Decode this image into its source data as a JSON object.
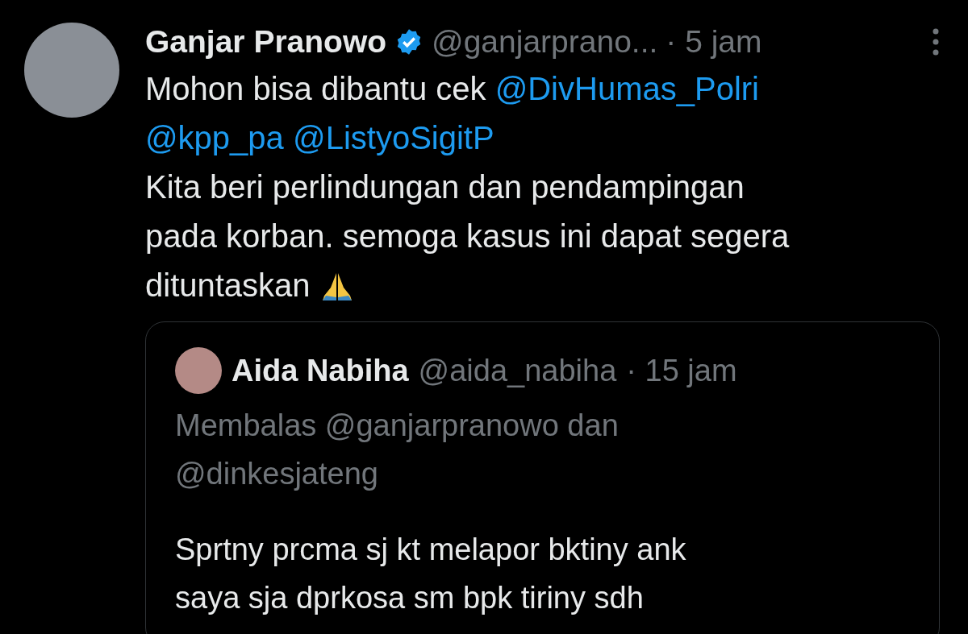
{
  "tweet": {
    "author": {
      "name": "Ganjar Pranowo",
      "verified": true,
      "handle": "@ganjarprano...",
      "time": "· 5 jam"
    },
    "body": [
      [
        {
          "kind": "text",
          "text": "Mohon bisa dibantu cek "
        },
        {
          "kind": "mention",
          "text": "@DivHumas_Polri"
        }
      ],
      [
        {
          "kind": "mention",
          "text": "@kpp_pa"
        },
        {
          "kind": "space"
        },
        {
          "kind": "mention",
          "text": "@ListyoSigitP"
        }
      ],
      [
        {
          "kind": "text",
          "text": "Kita beri perlindungan dan pendampingan"
        }
      ],
      [
        {
          "kind": "text",
          "text": "pada korban. semoga kasus ini dapat segera"
        }
      ],
      [
        {
          "kind": "text",
          "text": "dituntaskan "
        },
        {
          "kind": "emoji"
        }
      ]
    ],
    "quote": {
      "author": {
        "name": "Aida Nabiha",
        "handle": "@aida_nabiha",
        "time": "· 15 jam"
      },
      "reply_to": [
        "Membalas @ganjarpranowo dan",
        "@dinkesjateng"
      ],
      "body": [
        "Sprtny prcma sj kt melapor bktiny ank",
        "saya sja dprkosa sm bpk tiriny sdh"
      ]
    }
  }
}
